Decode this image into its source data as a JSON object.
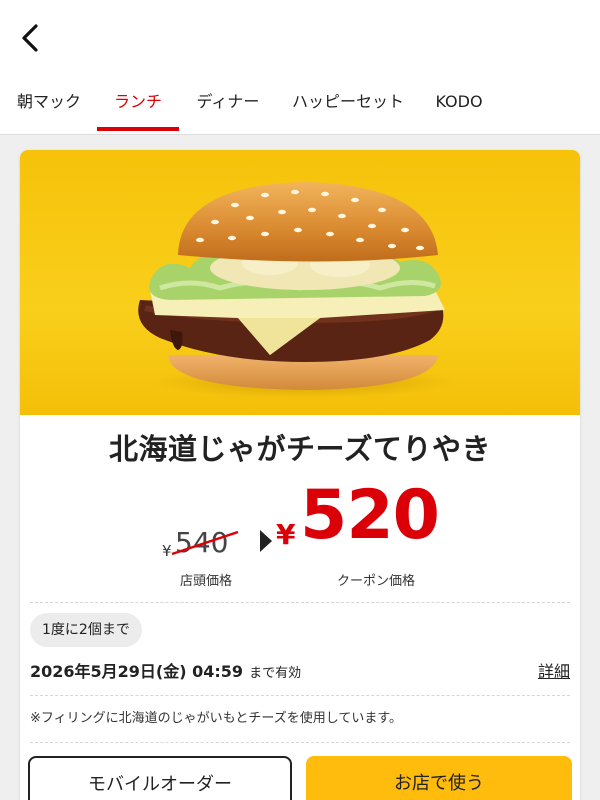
{
  "tabs": [
    {
      "label": "朝マック"
    },
    {
      "label": "ランチ"
    },
    {
      "label": "ディナー"
    },
    {
      "label": "ハッピーセット"
    },
    {
      "label": "KODO"
    }
  ],
  "active_tab": "ランチ",
  "colors": {
    "accent_red": "#db0007",
    "button_yellow": "#ffbc0d",
    "hero_yellow": "#f6c20a"
  },
  "product": {
    "name": "北海道じゃがチーズてりやき",
    "image_icon": "burger-image"
  },
  "pricing": {
    "currency_symbol": "¥",
    "original_price": "540",
    "original_label": "店頭価格",
    "coupon_price": "520",
    "coupon_label": "クーポン価格"
  },
  "limit_text": "1度に2個まで",
  "expiry": {
    "date": "2026年5月29日(金) 04:59",
    "suffix": "まで有効"
  },
  "details_label": "詳細",
  "note": "※フィリングに北海道のじゃがいもとチーズを使用しています。",
  "buttons": {
    "mobile_order": "モバイルオーダー",
    "use_in_store": "お店で使う"
  }
}
